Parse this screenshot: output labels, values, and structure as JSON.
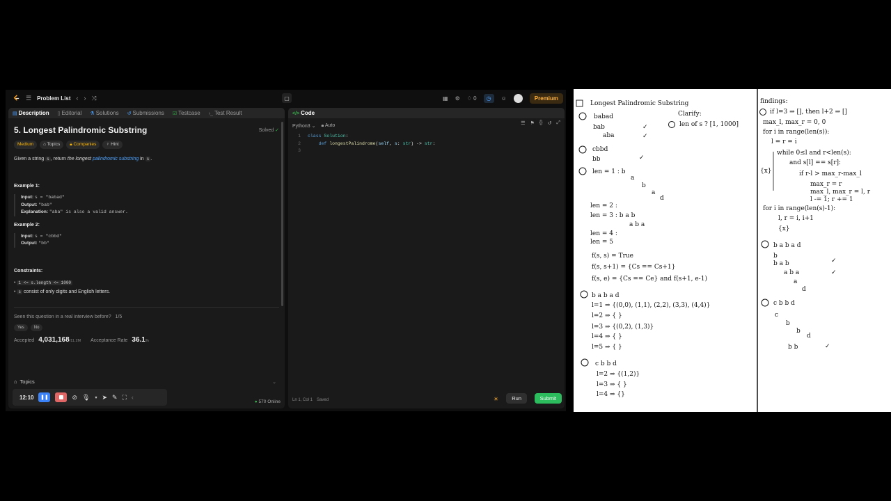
{
  "topbar": {
    "problem_list": "Problem List",
    "streak": "0",
    "premium": "Premium"
  },
  "left_tabs": [
    "Description",
    "Editorial",
    "Solutions",
    "Submissions",
    "Testcase",
    "Test Result"
  ],
  "problem": {
    "title": "5. Longest Palindromic Substring",
    "status": "Solved",
    "difficulty": "Medium",
    "chips": [
      "Topics",
      "Companies",
      "Hint"
    ],
    "desc_pre": "Given a string ",
    "desc_var": "s",
    "desc_mid": ", return ",
    "desc_em": "the longest",
    "desc_link": "palindromic substring",
    "desc_in": " in ",
    "desc_end": ".",
    "ex1_title": "Example 1:",
    "ex1_input": "s = \"babad\"",
    "ex1_output": "\"bab\"",
    "ex1_expl": "\"aba\" is also a valid answer.",
    "ex2_title": "Example 2:",
    "ex2_input": "s = \"cbbd\"",
    "ex2_output": "\"bb\"",
    "constraints_title": "Constraints:",
    "constraint1": "1 <= s.length <= 1000",
    "constraint2_code": "s",
    "constraint2_text": " consist of only digits and English letters.",
    "seen_q": "Seen this question in a real interview before?",
    "seen_count": "1/5",
    "yes": "Yes",
    "no": "No",
    "accepted_label": "Accepted",
    "accepted_value": "4,031,168",
    "accepted_total": "/11.2M",
    "rate_label": "Acceptance Rate",
    "rate_value": "36.1",
    "rate_unit": "%",
    "topics": "Topics",
    "online": "570 Online"
  },
  "recorder": {
    "time": "12:10"
  },
  "code": {
    "header": "Code",
    "language": "Python3",
    "mode": "Auto",
    "lines": [
      "1",
      "2",
      "3"
    ],
    "status": "Ln 1, Col 1",
    "saved": "Saved",
    "run": "Run",
    "submit": "Submit"
  },
  "notes": {
    "l_title": "Longest Palindromic Substring",
    "l1": "babad",
    "l2": "bab",
    "l3": "aba",
    "clarify": "Clarify:",
    "clarify1": "len of s ? [1, 1000]",
    "l4": "cbbd",
    "l5": "bb",
    "l6": "len = 1 : b",
    "l7": "a",
    "l8": "b",
    "l9": "a",
    "l10": "d",
    "l11": "len = 2 :",
    "l12": "len = 3 : b a b",
    "l13": "a b a",
    "l14": "len = 4 :",
    "l15": "len = 5",
    "l16": "f(s, s) = True",
    "l17": "f(s, s+1) = {Cs == Cs+1}",
    "l18": "f(s, e) = {Cs == Ce} and f(s+1, e-1)",
    "l19": "b a b a d",
    "l20": "l=1 ⇒ {(0,0), (1,1), (2,2), (3,3), (4,4)}",
    "l21": "l=2 ⇒ { }",
    "l22": "l=3 ⇒ {(0,2), (1,3)}",
    "l23": "l=4 ⇒ { }",
    "l24": "l=5 ⇒ { }",
    "l25": "c b b d",
    "l26": "l=2 ⇒ {(1,2)}",
    "l27": "l=3 ⇒ { }",
    "l28": "l=4 ⇒ {}",
    "r_title": "findings:",
    "r1": "if l=3 ⇒ [], then l+2 ⇒ []",
    "r2": "max_l, max_r = 0, 0",
    "r3": "for i in range(len(s)):",
    "r4": "l = r = i",
    "r5": "while 0≤l and r<len(s):",
    "r6": "and s[l] == s[r]:",
    "r7": "if r-l > max_r-max_l",
    "r8": "max_r = r",
    "r9": "max_l, max_r = l, r",
    "r10": "l -= 1; r += 1",
    "r11": "for i in range(len(s)-1):",
    "r12": "l, r = i, i+1",
    "r13": "{x}",
    "r14": "b a b a d",
    "r15": "b",
    "r16": "b a b",
    "r17": "a b a",
    "r18": "a",
    "r19": "d",
    "r20": "c b b d",
    "r21": "c",
    "r22": "b",
    "r23": "b",
    "r24": "d",
    "r25": "b b",
    "mark_x": "{x}"
  }
}
